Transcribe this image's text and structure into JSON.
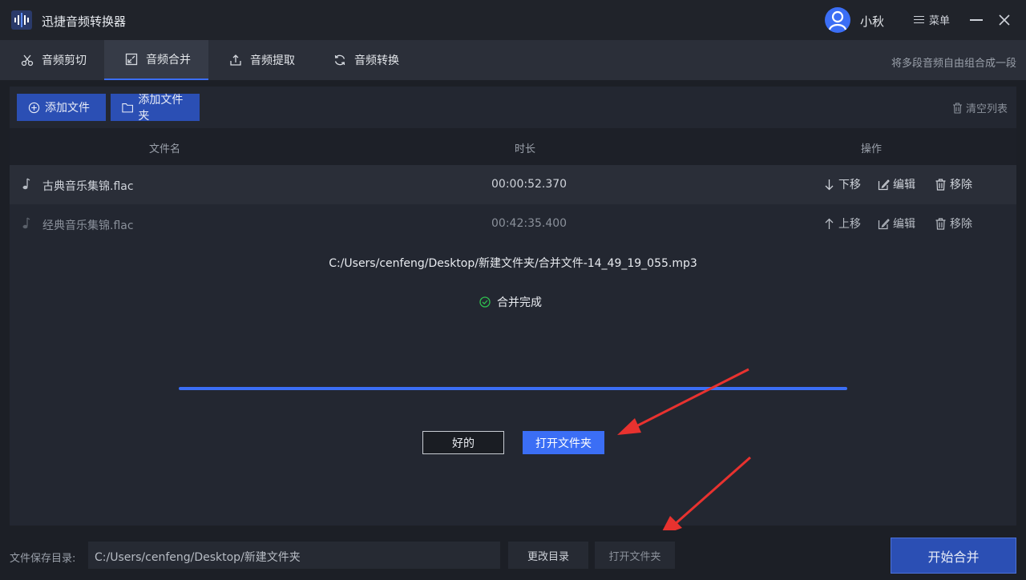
{
  "app": {
    "title": "迅捷音频转换器",
    "user": "小秋",
    "menu_label": "菜单"
  },
  "tabs": [
    {
      "label": "音频剪切",
      "icon": "scissors-icon"
    },
    {
      "label": "音频合并",
      "icon": "merge-icon",
      "active": true
    },
    {
      "label": "音频提取",
      "icon": "extract-icon"
    },
    {
      "label": "音频转换",
      "icon": "convert-icon"
    }
  ],
  "tab_hint": "将多段音频自由组合成一段",
  "toolbar": {
    "add_file": "添加文件",
    "add_folder": "添加文件夹",
    "clear_list": "清空列表"
  },
  "table": {
    "headers": [
      "文件名",
      "时长",
      "操作"
    ],
    "rows": [
      {
        "name": "古典音乐集锦.flac",
        "duration": "00:00:52.370",
        "move": "下移",
        "edit": "编辑",
        "remove": "移除"
      },
      {
        "name": "经典音乐集锦.flac",
        "duration": "00:42:35.400",
        "move": "上移",
        "edit": "编辑",
        "remove": "移除"
      }
    ]
  },
  "result": {
    "output_path": "C:/Users/cenfeng/Desktop/新建文件夹/合并文件-14_49_19_055.mp3",
    "status": "合并完成",
    "progress": 1.0,
    "ok_label": "好的",
    "open_folder_label": "打开文件夹"
  },
  "bottom": {
    "save_label": "文件保存目录:",
    "save_path": "C:/Users/cenfeng/Desktop/新建文件夹",
    "change_dir": "更改目录",
    "open_folder": "打开文件夹",
    "start": "开始合并"
  },
  "colors": {
    "accent": "#3b6ef5",
    "button": "#2b4fb4",
    "arrow": "#e8322f",
    "success": "#2fbf4f"
  }
}
